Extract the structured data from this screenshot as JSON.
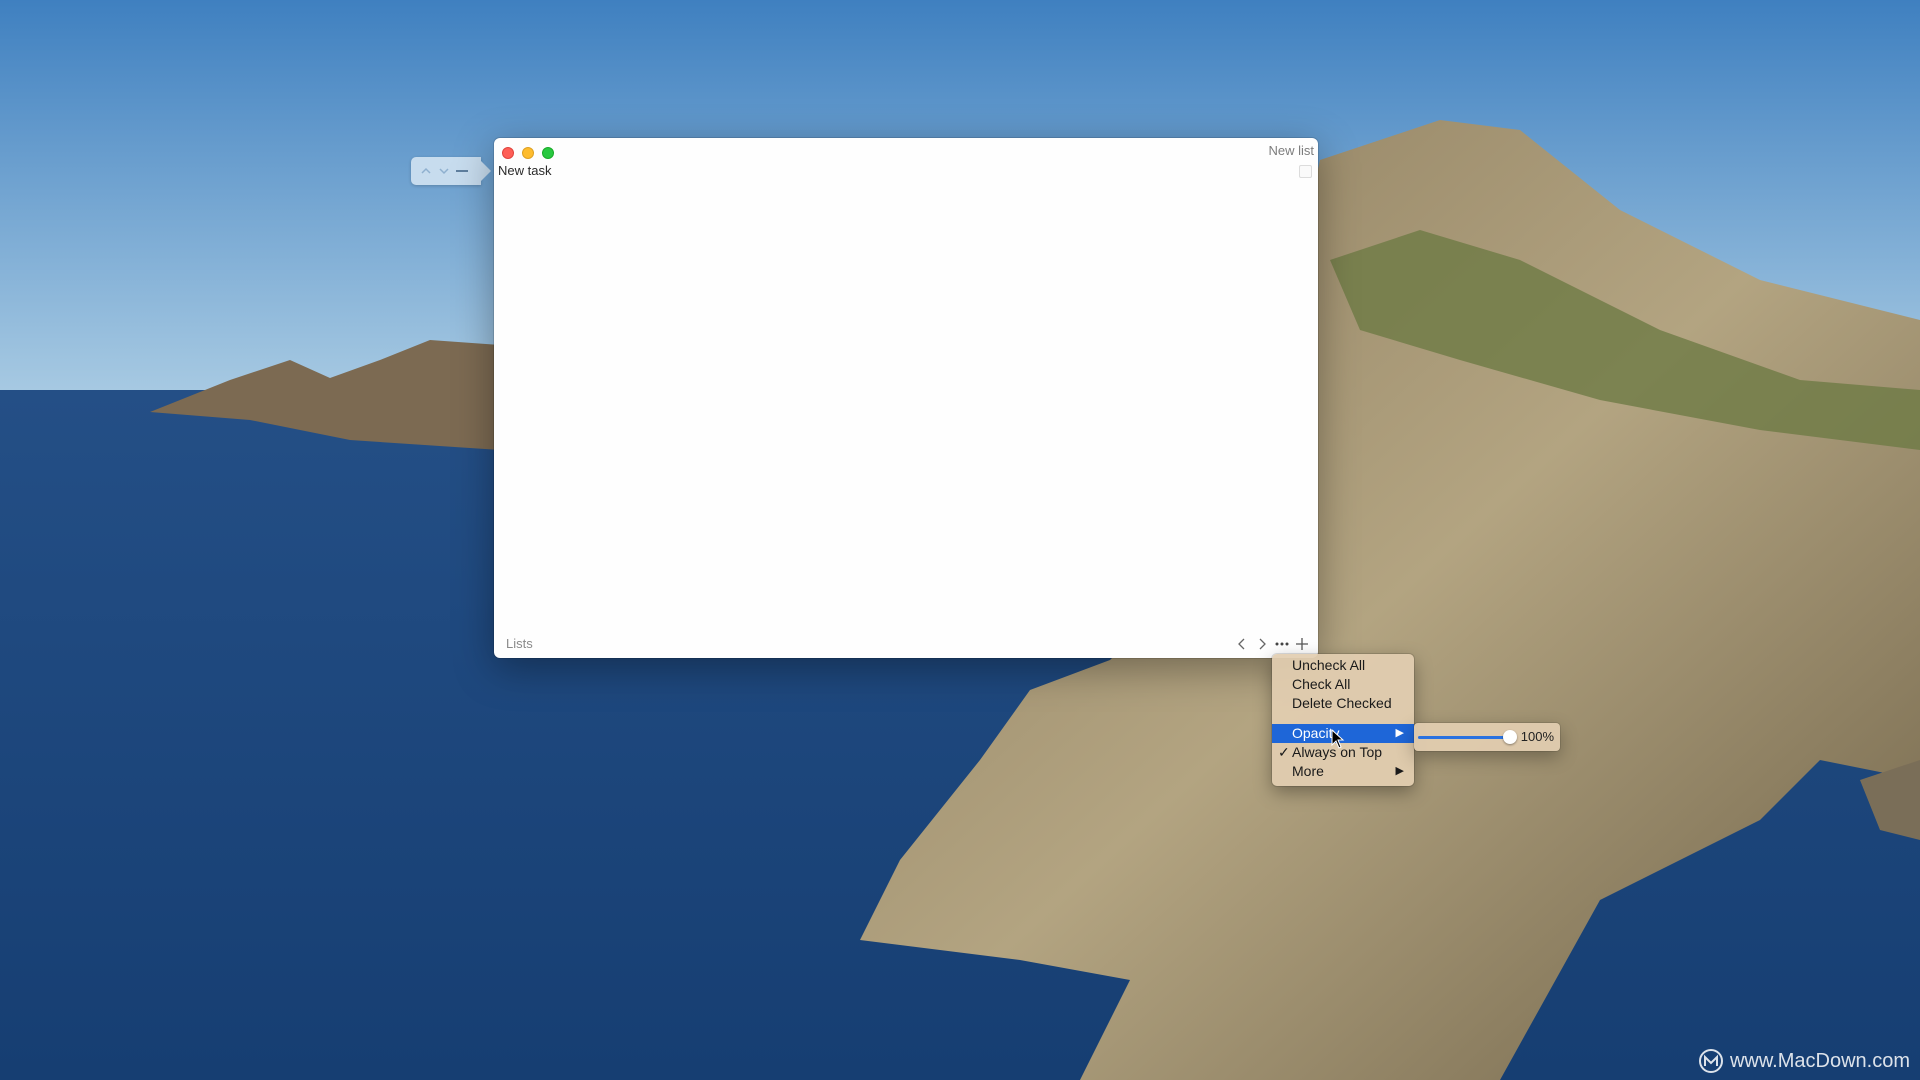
{
  "desktop": {
    "watermark_text": "www.MacDown.com"
  },
  "window": {
    "title": "New list",
    "task": {
      "text": "New task",
      "checked": false
    },
    "footer_label": "Lists",
    "footer_icons": [
      "chevron-left-icon",
      "chevron-right-icon",
      "ellipsis-icon",
      "plus-icon"
    ],
    "reorder_icons": [
      "chevron-up-icon",
      "chevron-down-icon",
      "minus-icon"
    ]
  },
  "context_menu": {
    "items": [
      {
        "label": "Uncheck All"
      },
      {
        "label": "Check All"
      },
      {
        "label": "Delete Checked"
      },
      {
        "label": "Opacity",
        "highlighted": true,
        "submenu": true
      },
      {
        "label": "Always on Top",
        "checked": true,
        "check_mark": "✓"
      },
      {
        "label": "More",
        "submenu": true
      }
    ],
    "submenu_arrow": "▶"
  },
  "opacity_submenu": {
    "value": 1.0,
    "value_label": "100%"
  },
  "colors": {
    "highlight": "#1e66d8",
    "menu_bg": "#e2ceb0",
    "close": "#fe5f57",
    "minimize": "#febc2e",
    "maximize": "#28c840"
  }
}
